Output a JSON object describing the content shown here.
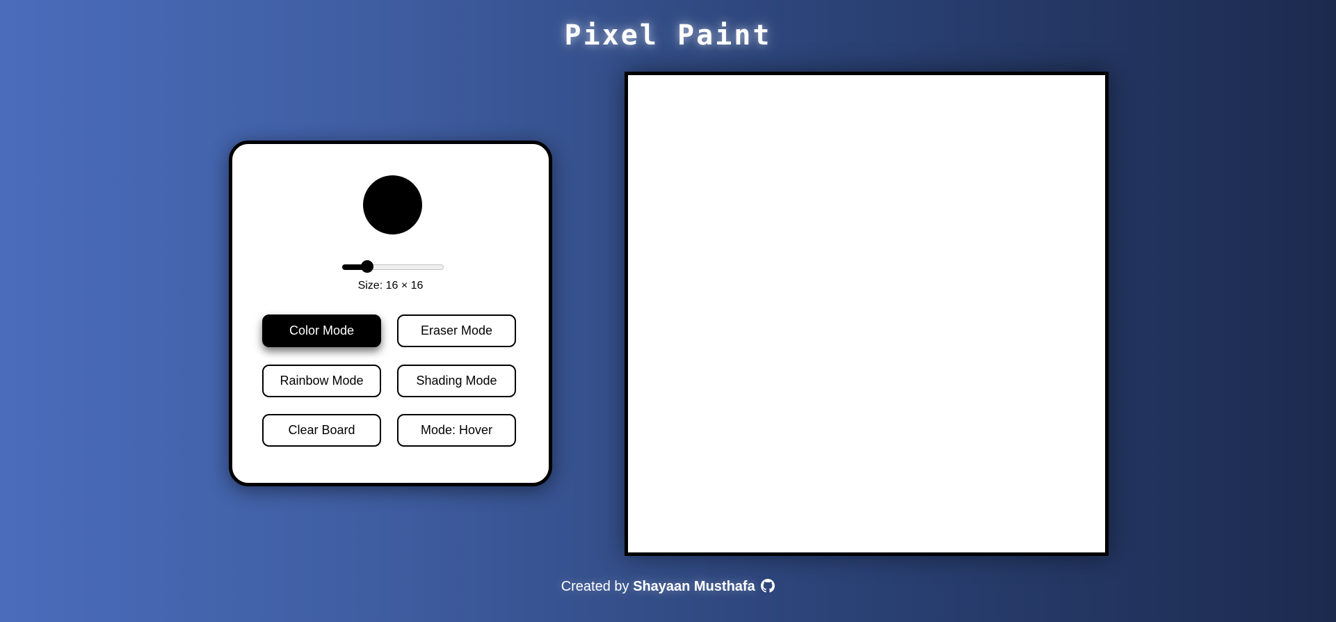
{
  "app": {
    "title": "Pixel Paint"
  },
  "controls": {
    "current_color": "#000000",
    "grid_size": {
      "value": 16,
      "min": 1,
      "max": 100,
      "label": "Size: 16 × 16"
    },
    "buttons": {
      "color_mode": "Color Mode",
      "eraser_mode": "Eraser Mode",
      "rainbow_mode": "Rainbow Mode",
      "shading_mode": "Shading Mode",
      "clear_board": "Clear Board",
      "draw_mode": "Mode: Hover"
    },
    "active_mode": "color_mode"
  },
  "footer": {
    "prefix": "Created by",
    "author": "Shayaan Musthafa",
    "icon": "github-icon"
  },
  "colors": {
    "background_start": "#4a6cbb",
    "background_end": "#1c2a4e",
    "accent": "#000000",
    "board": "#ffffff"
  }
}
